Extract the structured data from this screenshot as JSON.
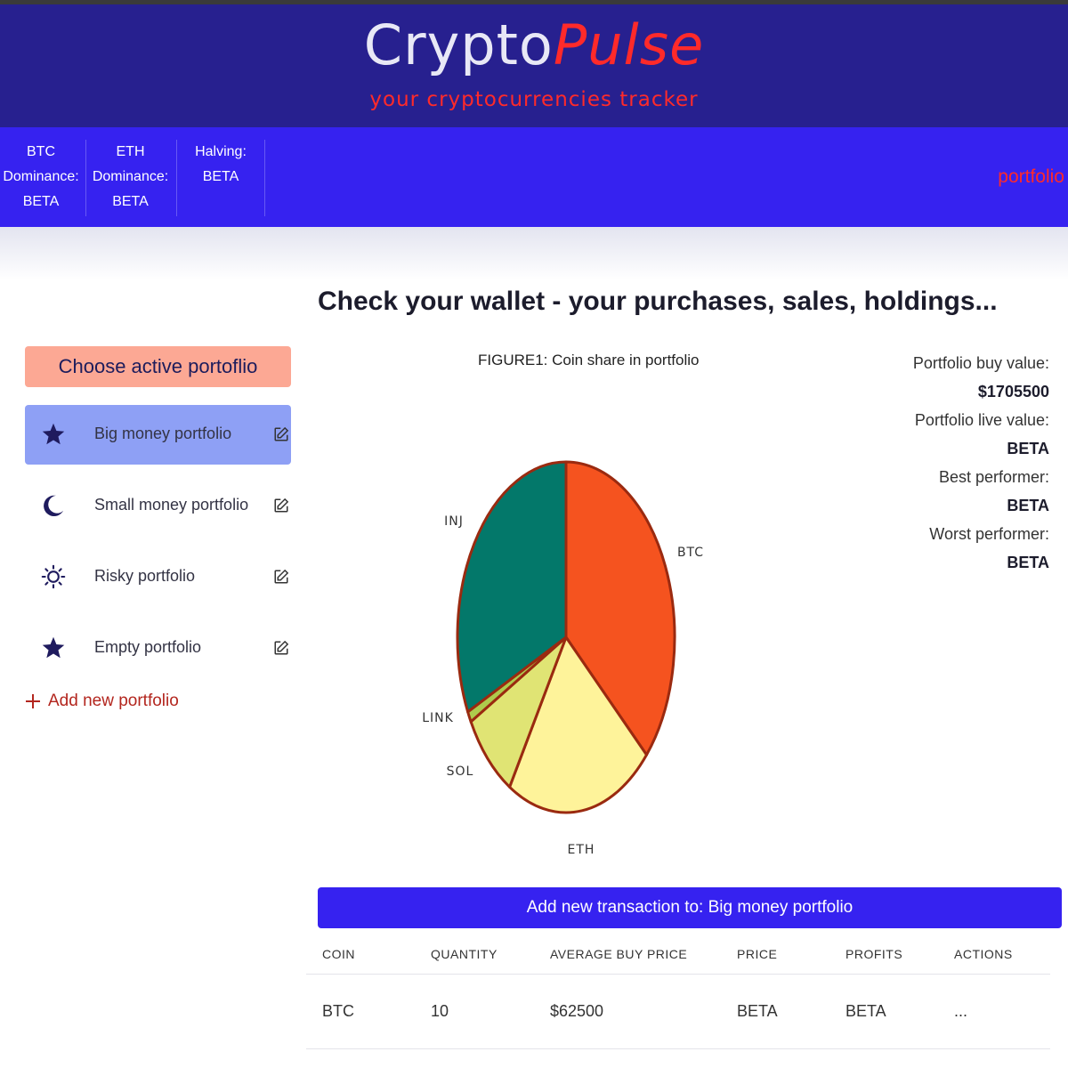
{
  "header": {
    "logo_part1": "Crypto",
    "logo_part2": "Pulse",
    "tagline": "your cryptocurrencies tracker"
  },
  "stats_bar": {
    "btc_label_1": "BTC",
    "btc_label_2": "Dominance:",
    "btc_value": "BETA",
    "eth_label_1": "ETH",
    "eth_label_2": "Dominance:",
    "eth_value": "BETA",
    "halving_label": "Halving:",
    "halving_value": "BETA",
    "nav_portfolio": "portfolio"
  },
  "page": {
    "title": "Check your wallet - your purchases, sales, holdings..."
  },
  "sidebar": {
    "choose_label": "Choose active portoflio",
    "portfolios": [
      {
        "label": "Big money portfolio",
        "icon": "star-icon",
        "active": true
      },
      {
        "label": "Small money portfolio",
        "icon": "moon-icon",
        "active": false
      },
      {
        "label": "Risky portfolio",
        "icon": "sun-icon",
        "active": false
      },
      {
        "label": "Empty portfolio",
        "icon": "star-icon",
        "active": false
      }
    ],
    "add_label": "Add new portfolio"
  },
  "chart_data": {
    "type": "pie",
    "title": "FIGURE1: Coin share in portfolio",
    "labels": [
      "BTC",
      "ETH",
      "SOL",
      "LINK",
      "INJ"
    ],
    "values": [
      36.7,
      22.0,
      8.3,
      1.0,
      32.0
    ],
    "colors": [
      "#f5531f",
      "#fef39a",
      "#e0e474",
      "#aecb4d",
      "#03786a"
    ],
    "edge_color": "#9a2a10"
  },
  "summary": {
    "buy_label": "Portfolio buy value:",
    "buy_value": "$1705500",
    "live_label": "Portfolio live value:",
    "live_value": "BETA",
    "best_label": "Best performer:",
    "best_value": "BETA",
    "worst_label": "Worst performer:",
    "worst_value": "BETA"
  },
  "transactions": {
    "add_label": "Add new transaction to: Big money portfolio",
    "columns": [
      "COIN",
      "QUANTITY",
      "AVERAGE BUY PRICE",
      "PRICE",
      "PROFITS",
      "ACTIONS"
    ],
    "rows": [
      [
        "BTC",
        "10",
        "$62500",
        "BETA",
        "BETA",
        "..."
      ]
    ]
  },
  "colors": {
    "header_bg": "#27208f",
    "statsbar_bg": "#3622f0",
    "accent_red": "#ff2a2a",
    "choose_bg": "#fca894",
    "active_item_bg": "#8ea0f5",
    "add_tx_bg": "#3622f0"
  }
}
